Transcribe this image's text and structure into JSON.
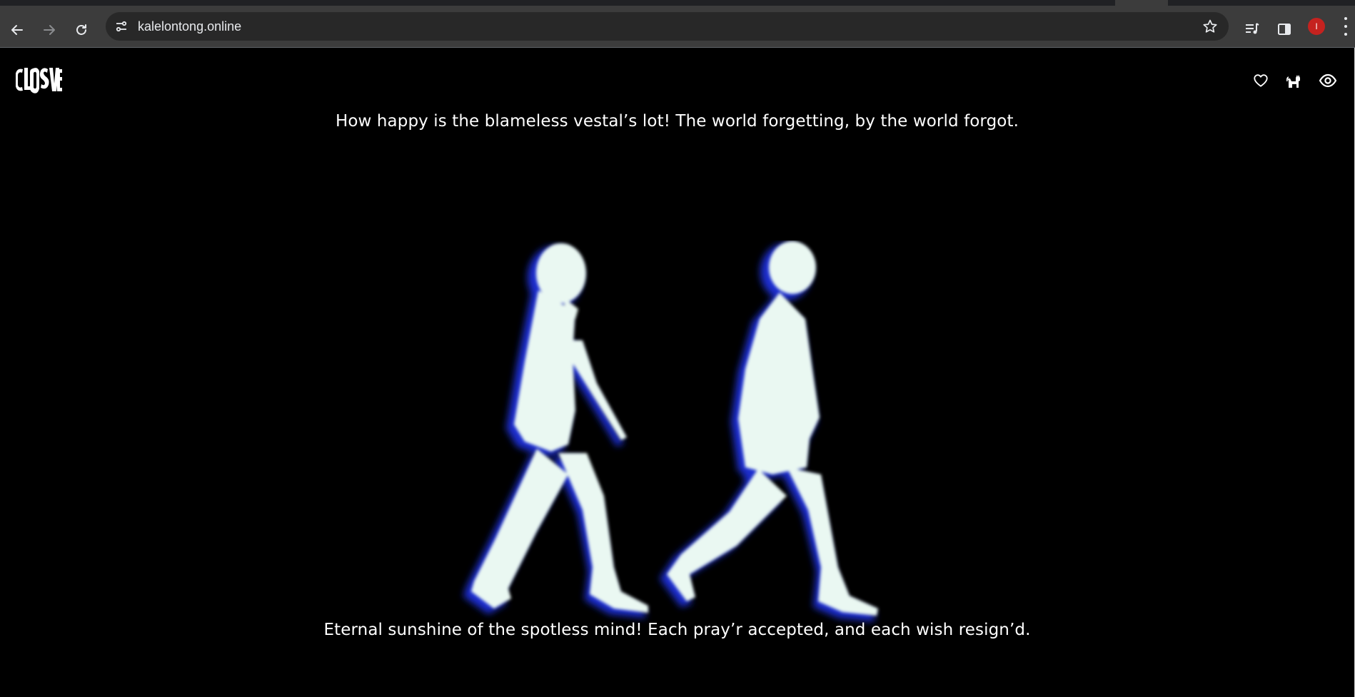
{
  "browser": {
    "url": "kalelontong.online",
    "profile_initial": "I",
    "icons": {
      "back": "arrow-left-icon",
      "forward": "arrow-right-icon",
      "reload": "reload-icon",
      "site_info": "tune-icon",
      "bookmark": "star-icon",
      "media": "media-queue-icon",
      "side_panel": "side-panel-icon",
      "menu": "kebab-menu-icon"
    }
  },
  "site": {
    "logo_text": "CLOSURE",
    "header_icons": [
      "heart-icon",
      "cat-icon",
      "eye-icon"
    ],
    "quote_top": "How happy is the blameless vestal’s lot! The world forgetting, by the world forgot.",
    "quote_bottom": "Eternal sunshine of the spotless mind! Each pray’r accepted, and each wish resign’d.",
    "hero_image": "two-walking-silhouettes",
    "colors": {
      "background": "#000000",
      "text": "#ffffff",
      "glow": "#eaf8f2",
      "glow_edge": "#1a2fd0"
    }
  }
}
